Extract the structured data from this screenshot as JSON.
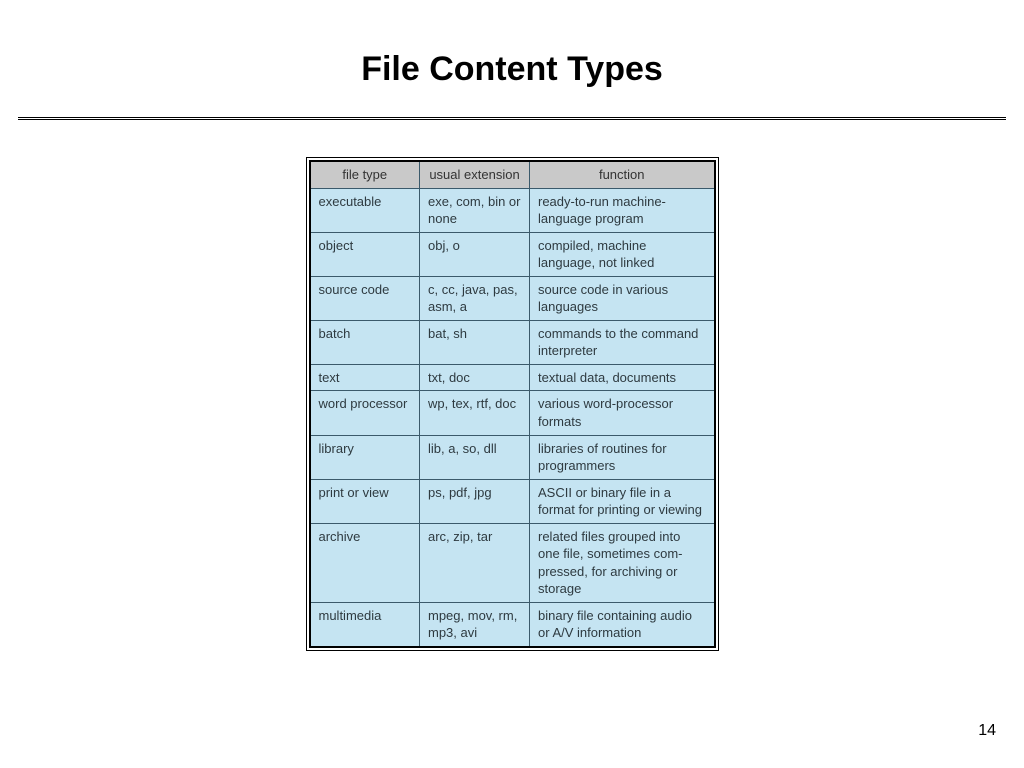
{
  "title": "File Content Types",
  "page_number": "14",
  "headers": {
    "col1": "file type",
    "col2": "usual extension",
    "col3": "function"
  },
  "rows": [
    {
      "type": "executable",
      "ext": "exe, com, bin or none",
      "func": "ready-to-run machine-language program"
    },
    {
      "type": "object",
      "ext": "obj, o",
      "func": "compiled, machine language, not linked"
    },
    {
      "type": "source code",
      "ext": "c, cc, java, pas, asm, a",
      "func": "source code in various languages"
    },
    {
      "type": "batch",
      "ext": "bat, sh",
      "func": "commands to the command interpreter"
    },
    {
      "type": "text",
      "ext": "txt, doc",
      "func": "textual data, documents"
    },
    {
      "type": "word processor",
      "ext": "wp, tex, rtf, doc",
      "func": "various word-processor formats"
    },
    {
      "type": "library",
      "ext": "lib, a, so, dll",
      "func": "libraries of routines for programmers"
    },
    {
      "type": "print or view",
      "ext": "ps, pdf, jpg",
      "func": "ASCII or binary file in a format for printing or viewing"
    },
    {
      "type": "archive",
      "ext": "arc, zip, tar",
      "func": "related files grouped into one file, sometimes com-pressed, for archiving or storage"
    },
    {
      "type": "multimedia",
      "ext": "mpeg, mov, rm, mp3, avi",
      "func": "binary file containing audio or A/V information"
    }
  ]
}
